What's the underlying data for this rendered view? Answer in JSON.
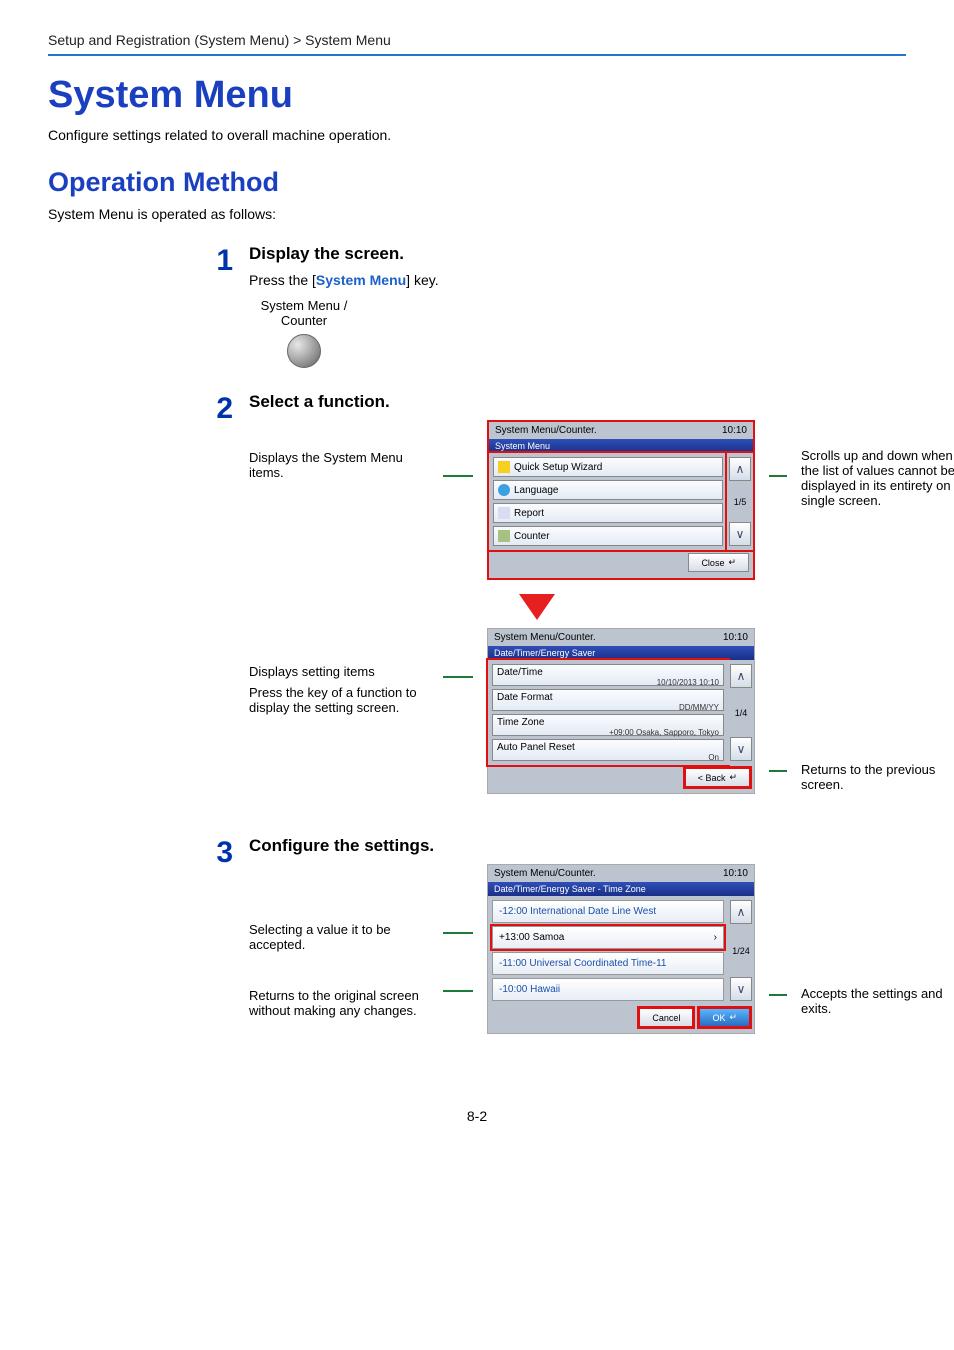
{
  "breadcrumb": "Setup and Registration (System Menu) > System Menu",
  "h1": "System Menu",
  "intro": "Configure settings related to overall machine operation.",
  "h2": "Operation Method",
  "subintro": "System Menu is operated as follows:",
  "steps": {
    "one": {
      "num": "1",
      "title": "Display the screen.",
      "text_pre": "Press the [",
      "text_key": "System Menu",
      "text_post": "] key.",
      "key_label_l1": "System Menu /",
      "key_label_l2": "Counter"
    },
    "two": {
      "num": "2",
      "title": "Select a function.",
      "callout_left_1": "Displays the System Menu items.",
      "callout_right_1": "Scrolls up and down when the list of values cannot be displayed in its entirety on a single screen.",
      "callout_left_2a": "Displays setting items",
      "callout_left_2b": "Press the key of a function to display the setting screen.",
      "callout_right_2": "Returns to the previous screen."
    },
    "three": {
      "num": "3",
      "title": "Configure the settings.",
      "callout_left_3a": "Selecting a value it to be accepted.",
      "callout_left_3b": "Returns to the original screen without making any changes.",
      "callout_right_3": "Accepts the settings and exits."
    }
  },
  "panel1": {
    "hdr": "System Menu/Counter.",
    "time": "10:10",
    "sub": "System Menu",
    "rows": [
      "Quick Setup Wizard",
      "Language",
      "Report",
      "Counter"
    ],
    "page": "1/5",
    "close": "Close"
  },
  "panel2": {
    "hdr": "System Menu/Counter.",
    "time": "10:10",
    "sub": "Date/Timer/Energy Saver",
    "rows": [
      {
        "k": "Date/Time",
        "v": "10/10/2013 10:10"
      },
      {
        "k": "Date Format",
        "v": "DD/MM/YY"
      },
      {
        "k": "Time Zone",
        "v": "+09:00 Osaka, Sapporo, Tokyo"
      },
      {
        "k": "Auto Panel Reset",
        "v": "On"
      }
    ],
    "page": "1/4",
    "back": "< Back"
  },
  "panel3": {
    "hdr": "System Menu/Counter.",
    "time": "10:10",
    "sub": "Date/Timer/Energy Saver - Time Zone",
    "rows": [
      "-12:00 International Date Line West",
      "+13:00 Samoa",
      "-11:00 Universal Coordinated Time-11",
      "-10:00 Hawaii"
    ],
    "page": "1/24",
    "cancel": "Cancel",
    "ok": "OK"
  },
  "pagefoot": "8-2"
}
